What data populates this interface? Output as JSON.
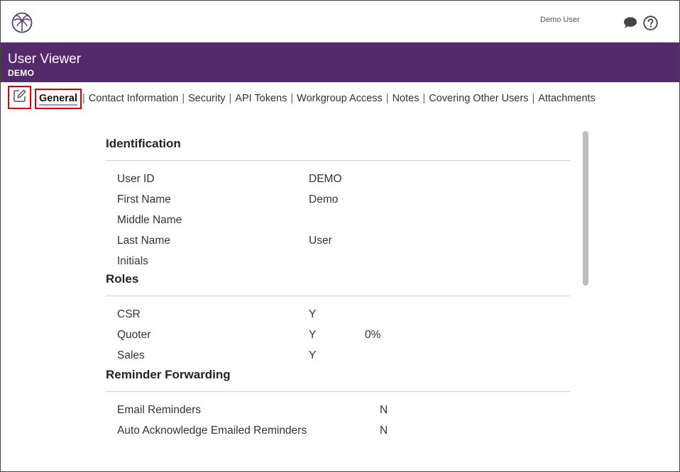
{
  "topbar": {
    "logo_icon": "palm-tree-logo-icon",
    "user_name": "Demo User",
    "chat_icon": "chat-bubble-icon",
    "help_icon": "help-circle-icon"
  },
  "header": {
    "title": "User Viewer",
    "subtitle": "DEMO",
    "background": "#542a6b"
  },
  "tabs": [
    {
      "label": "General",
      "active": true
    },
    {
      "label": "Contact Information"
    },
    {
      "label": "Security"
    },
    {
      "label": "API Tokens"
    },
    {
      "label": "Workgroup Access"
    },
    {
      "label": "Notes"
    },
    {
      "label": "Covering Other Users"
    },
    {
      "label": "Attachments"
    }
  ],
  "identification": {
    "title": "Identification",
    "rows": [
      {
        "label": "User ID",
        "value": "DEMO"
      },
      {
        "label": "First Name",
        "value": "Demo"
      },
      {
        "label": "Middle Name",
        "value": ""
      },
      {
        "label": "Last Name",
        "value": "User"
      },
      {
        "label": "Initials",
        "value": ""
      }
    ]
  },
  "roles": {
    "title": "Roles",
    "rows": [
      {
        "label": "CSR",
        "value": "Y",
        "extra": ""
      },
      {
        "label": "Quoter",
        "value": "Y",
        "extra": "0%"
      },
      {
        "label": "Sales",
        "value": "Y",
        "extra": ""
      }
    ]
  },
  "reminder_forwarding": {
    "title": "Reminder Forwarding",
    "rows": [
      {
        "label": "Email Reminders",
        "value": "N"
      },
      {
        "label": "Auto Acknowledge Emailed Reminders",
        "value": "N"
      }
    ]
  },
  "colors": {
    "highlight_border": "#e00000",
    "active_tab_underline": "#6ea7d8"
  }
}
